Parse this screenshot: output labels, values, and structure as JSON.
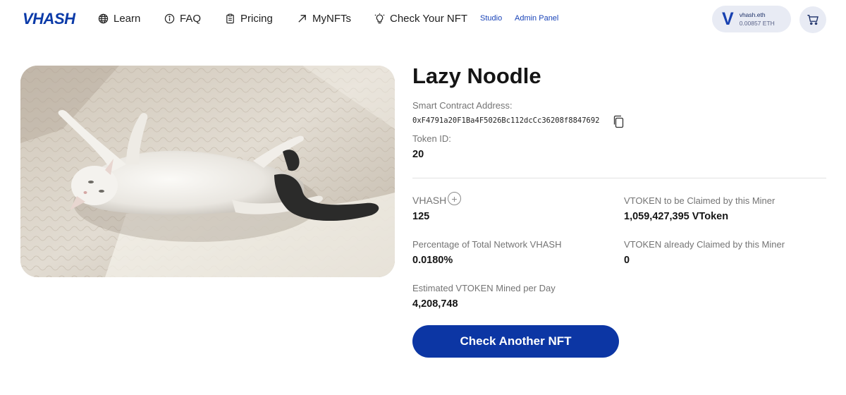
{
  "nav": {
    "logo": "VHASH",
    "items": [
      {
        "label": "Learn",
        "icon": "globe-icon"
      },
      {
        "label": "FAQ",
        "icon": "info-icon"
      },
      {
        "label": "Pricing",
        "icon": "clipboard-icon"
      },
      {
        "label": "MyNFTs",
        "icon": "arrow-up-right-icon"
      },
      {
        "label": "Check Your NFT",
        "icon": "lightbulb-icon"
      }
    ],
    "links": [
      "Studio",
      "Admin Panel"
    ],
    "wallet": {
      "initial": "V",
      "name": "vhash.eth",
      "balance": "0.00857 ETH"
    },
    "cart_icon": "cart-icon"
  },
  "nft": {
    "title": "Lazy Noodle",
    "image_alt": "white cat lying on its back on a fluffy rug",
    "contract_label": "Smart Contract Address:",
    "contract_address": "0xF4791a20F1Ba4F5026Bc112dcCc36208f8847692",
    "token_label": "Token ID:",
    "token_id": "20"
  },
  "stats": {
    "vhash_label": "VHASH",
    "vhash_value": "125",
    "pct_label": "Percentage of Total Network VHASH",
    "pct_value": "0.0180%",
    "est_label": "Estimated VTOKEN Mined per Day",
    "est_value": "4,208,748",
    "claim_label": "VTOKEN to be Claimed by this Miner",
    "claim_value": "1,059,427,395 VToken",
    "claimed_label": "VTOKEN already Claimed by this Miner",
    "claimed_value": "0"
  },
  "cta": {
    "label": "Check Another NFT"
  },
  "colors": {
    "brand": "#0c36a4",
    "text": "#151515",
    "muted": "#747474",
    "pill": "#e8ebf4"
  }
}
